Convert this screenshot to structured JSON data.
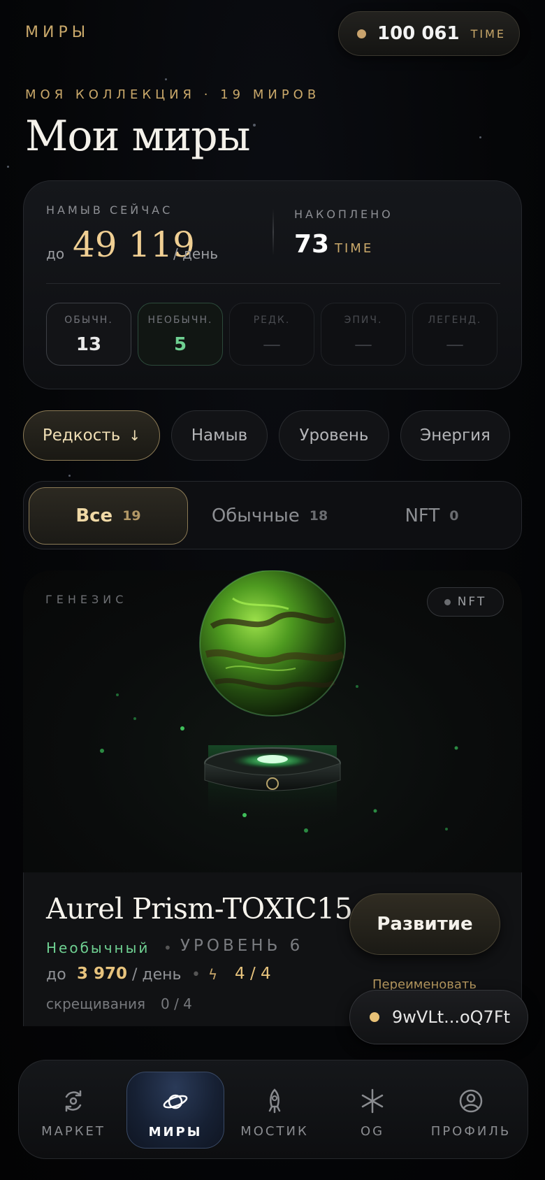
{
  "header": {
    "section_title": "МИРЫ",
    "balance_value": "100 061",
    "balance_unit": "TIME"
  },
  "subheader": "МОЯ КОЛЛЕКЦИЯ · 19 МИРОВ",
  "page_title": "Мои миры",
  "stats": {
    "mining_label": "НАМЫВ СЕЙЧАС",
    "mining_prefix": "до",
    "mining_value": "49 119",
    "mining_unit": "/ день",
    "accumulated_label": "НАКОПЛЕНО",
    "accumulated_value": "73",
    "accumulated_unit": "TIME",
    "rarities": [
      {
        "label": "ОБЫЧН.",
        "value": "13"
      },
      {
        "label": "НЕОБЫЧН.",
        "value": "5"
      },
      {
        "label": "РЕДК.",
        "value": "—"
      },
      {
        "label": "ЭПИЧ.",
        "value": "—"
      },
      {
        "label": "ЛЕГЕНД.",
        "value": "—"
      }
    ]
  },
  "sort": {
    "options": [
      "Редкость",
      "Намыв",
      "Уровень",
      "Энергия"
    ],
    "active_arrow": "↓"
  },
  "filter": {
    "tabs": [
      {
        "label": "Все",
        "count": "19"
      },
      {
        "label": "Обычные",
        "count": "18"
      },
      {
        "label": "NFT",
        "count": "0"
      }
    ]
  },
  "world_card": {
    "collection": "ГЕНЕЗИС",
    "badge": "NFT",
    "name": "Aurel Prism-TOXIC15",
    "rarity": "Необычный",
    "separator": "•",
    "level": "УРОВЕНЬ 6",
    "rate_prefix": "до",
    "rate_value": "3 970",
    "rate_unit": "/ день",
    "energy": "4 / 4",
    "crossings_label": "скрещивания",
    "crossings_value": "0 / 4",
    "develop_button": "Развитие",
    "rename_link": "Переименовать",
    "planet_color": "#3f8f1e"
  },
  "wallet": {
    "address": "9wVLt...oQ7Ft"
  },
  "nav": {
    "items": [
      {
        "label": "МАРКЕТ",
        "icon": "market-icon"
      },
      {
        "label": "МИРЫ",
        "icon": "planet-icon"
      },
      {
        "label": "МОСТИК",
        "icon": "rocket-icon"
      },
      {
        "label": "OG",
        "icon": "asterisk-icon"
      },
      {
        "label": "ПРОФИЛЬ",
        "icon": "user-icon"
      }
    ],
    "active": "МИРЫ"
  }
}
